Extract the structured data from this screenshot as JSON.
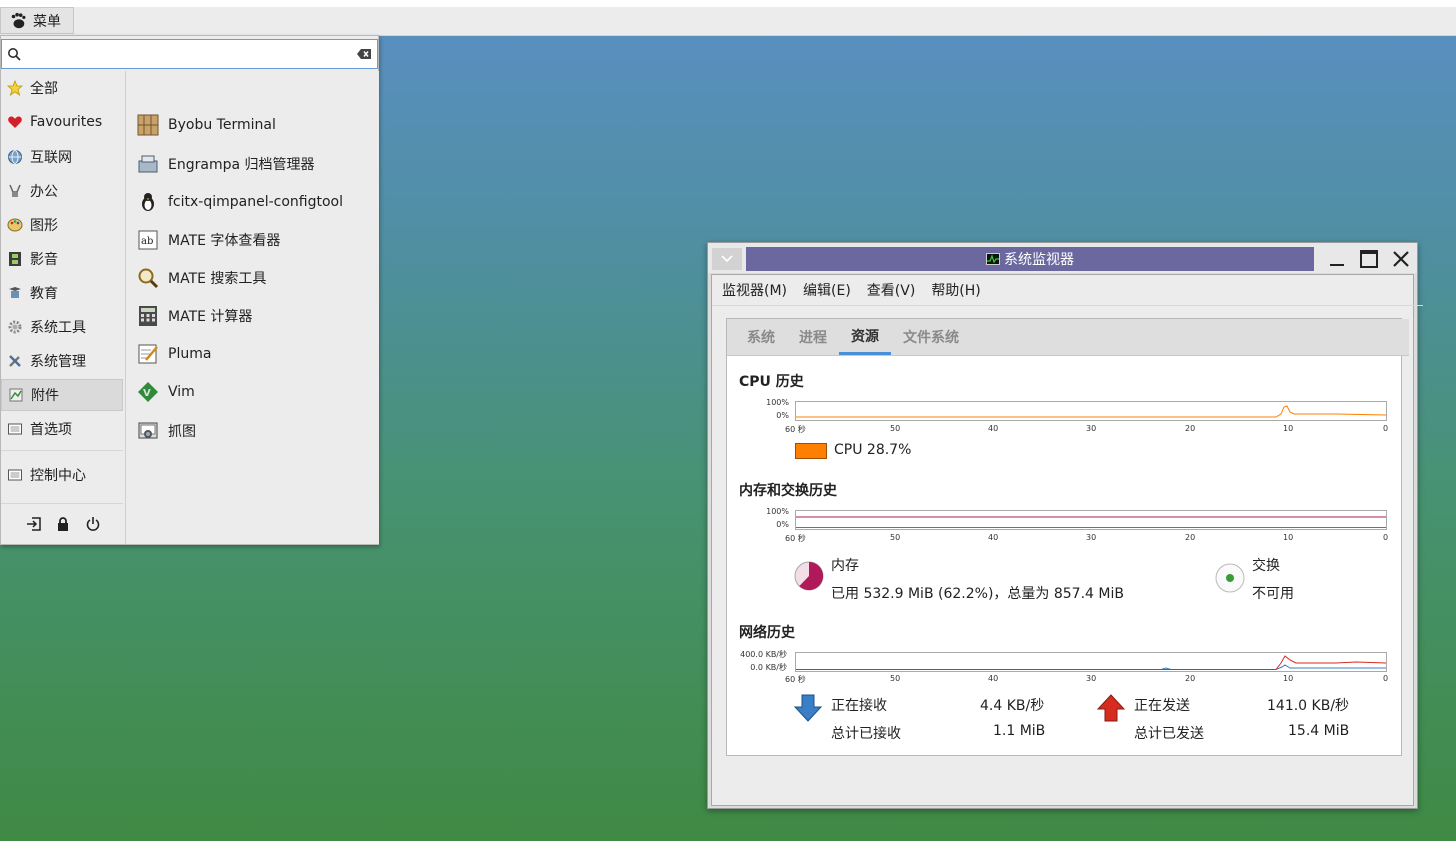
{
  "panel": {
    "menu_label": "菜单"
  },
  "menu": {
    "search_value": "",
    "categories": [
      {
        "label": "全部",
        "icon": "star-icon"
      },
      {
        "label": "Favourites",
        "icon": "heart-icon"
      },
      {
        "label": "互联网",
        "icon": "globe-icon"
      },
      {
        "label": "办公",
        "icon": "office-icon"
      },
      {
        "label": "图形",
        "icon": "palette-icon"
      },
      {
        "label": "影音",
        "icon": "film-icon"
      },
      {
        "label": "教育",
        "icon": "education-icon"
      },
      {
        "label": "系统工具",
        "icon": "gear-icon"
      },
      {
        "label": "系统管理",
        "icon": "tools-icon"
      },
      {
        "label": "附件",
        "icon": "accessories-icon"
      },
      {
        "label": "首选项",
        "icon": "preferences-icon"
      },
      {
        "label": "控制中心",
        "icon": "control-center-icon"
      }
    ],
    "selected_category": "附件",
    "apps": [
      {
        "label": "Byobu Terminal",
        "icon": "byobu-icon"
      },
      {
        "label": "Engrampa 归档管理器",
        "icon": "archive-icon"
      },
      {
        "label": "fcitx-qimpanel-configtool",
        "icon": "penguin-icon"
      },
      {
        "label": "MATE 字体查看器",
        "icon": "font-viewer-icon"
      },
      {
        "label": "MATE 搜索工具",
        "icon": "magnifier-icon"
      },
      {
        "label": "MATE 计算器",
        "icon": "calculator-icon"
      },
      {
        "label": "Pluma",
        "icon": "text-editor-icon"
      },
      {
        "label": "Vim",
        "icon": "vim-icon"
      },
      {
        "label": "抓图",
        "icon": "screenshot-icon"
      }
    ]
  },
  "window": {
    "title": "系统监视器",
    "menus": [
      "监视器(M)",
      "编辑(E)",
      "查看(V)",
      "帮助(H)"
    ],
    "tabs": [
      "系统",
      "进程",
      "资源",
      "文件系统"
    ],
    "active_tab": "资源",
    "x_ticks": [
      "60 秒",
      "50",
      "40",
      "30",
      "20",
      "10",
      "0"
    ],
    "cpu": {
      "title": "CPU 历史",
      "y_ticks": [
        "100%",
        "0%"
      ],
      "label": "CPU",
      "value": "28.7%",
      "color": "#ff7f00"
    },
    "memory": {
      "title": "内存和交换历史",
      "y_ticks": [
        "100%",
        "0%"
      ],
      "mem_label": "内存",
      "mem_detail": "已用 532.9 MiB (62.2%)，总量为 857.4 MiB",
      "mem_color": "#b0195a",
      "mem_fraction": 0.622,
      "swap_label": "交换",
      "swap_detail": "不可用",
      "swap_color": "#3a9a3a"
    },
    "network": {
      "title": "网络历史",
      "y_ticks": [
        "400.0 KB/秒",
        "0.0 KB/秒"
      ],
      "recv_label": "正在接收",
      "recv_value": "4.4 KB/秒",
      "recv_total_label": "总计已接收",
      "recv_total_value": "1.1 MiB",
      "send_label": "正在发送",
      "send_value": "141.0 KB/秒",
      "send_total_label": "总计已发送",
      "send_total_value": "15.4 MiB",
      "recv_color": "#3b7ec8",
      "send_color": "#d62b1f"
    }
  }
}
